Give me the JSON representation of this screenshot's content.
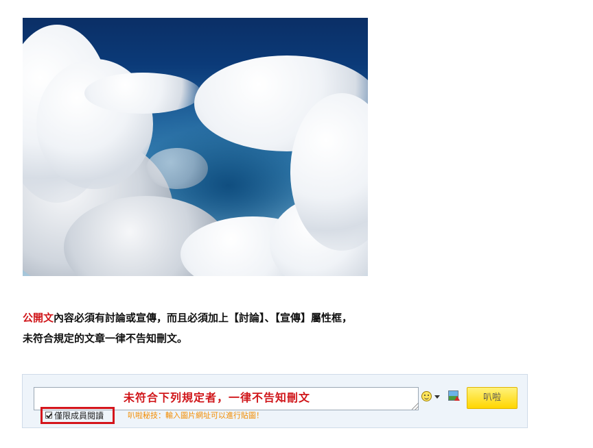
{
  "post": {
    "image_alt": "Aerial view of clouds over a deep blue sky",
    "notice_highlight": "公開文",
    "notice_line1_rest": "內容必須有討論或宣傳，而且必須加上【討論】、【宣傳】屬性框，",
    "notice_line2": "未符合規定的文章一律不告知刪文。"
  },
  "comment": {
    "placeholder": "未符合下列規定者，一律不告知刪文",
    "emoji_icon": "smiley-icon",
    "image_icon": "insert-image-icon",
    "submit_label": "叭啦",
    "members_only_label": "僅限成員閱讀",
    "members_only_checked": true,
    "tip": "叭啦秘技：輸入圖片網址可以進行貼圖！"
  }
}
